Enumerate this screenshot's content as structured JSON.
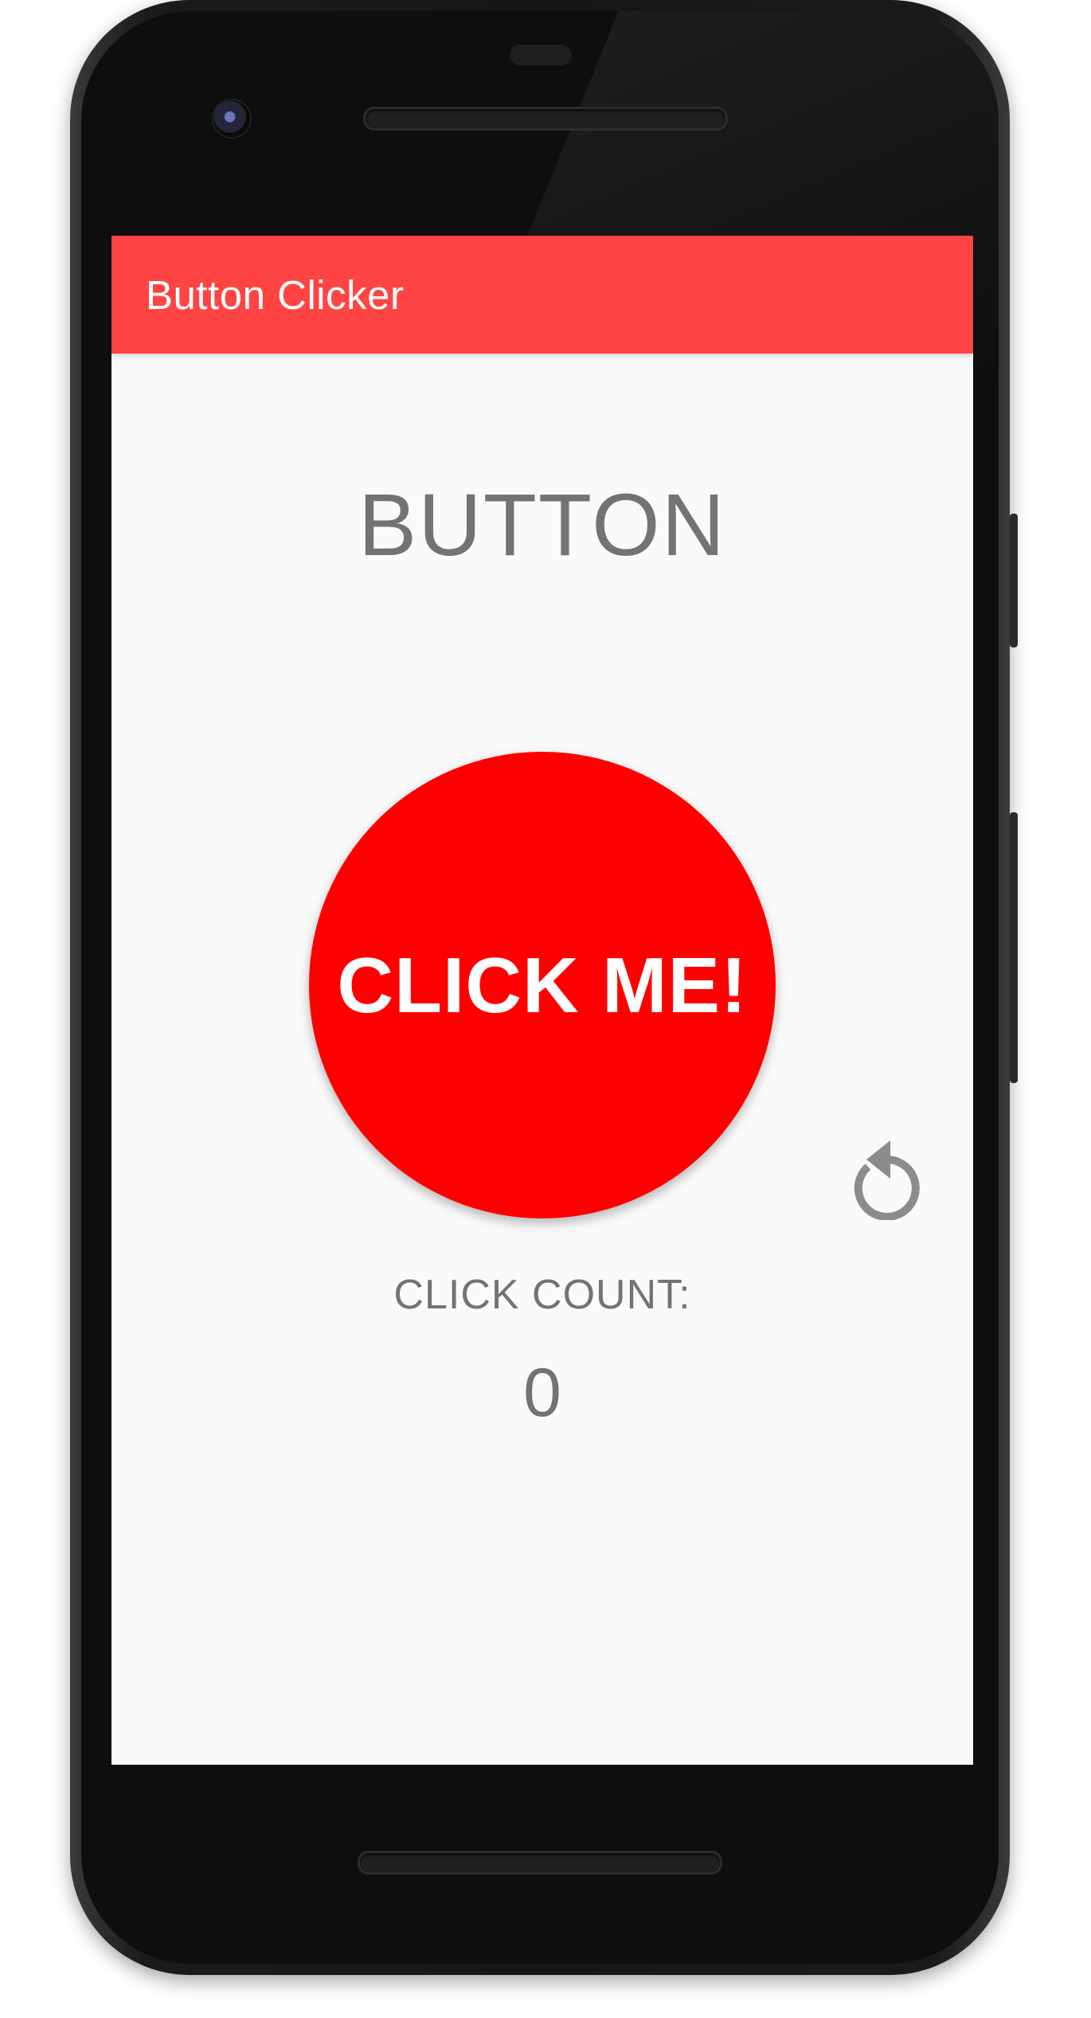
{
  "app": {
    "title": "Button Clicker"
  },
  "main": {
    "heading": "BUTTON",
    "click_button_label": "CLICK ME!",
    "count_label": "CLICK COUNT:",
    "count_value": "0"
  },
  "icons": {
    "reset": "refresh-icon"
  },
  "colors": {
    "app_bar": "#ff4444",
    "click_button": "#ff0000",
    "text_muted": "#737373",
    "background": "#fafafa"
  }
}
